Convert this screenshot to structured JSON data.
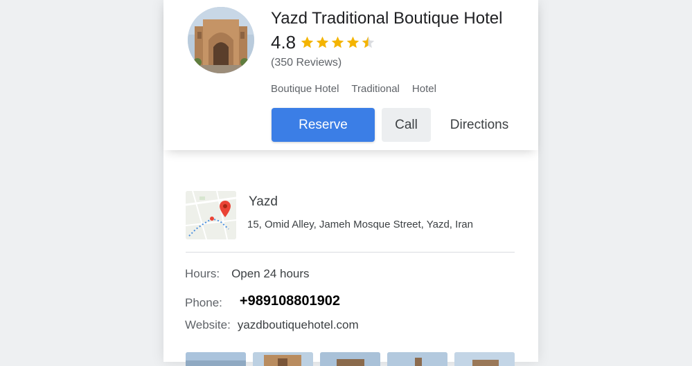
{
  "hotel": {
    "name": "Yazd Traditional Boutique Hotel",
    "rating": "4.8",
    "stars_value": 4.5,
    "reviews": "(350 Reviews)",
    "tags": [
      "Boutique Hotel",
      "Traditional",
      "Hotel"
    ]
  },
  "actions": {
    "reserve": "Reserve",
    "call": "Call",
    "directions": "Directions"
  },
  "location": {
    "city": "Yazd",
    "address": "15, Omid Alley, Jameh Mosque Street, Yazd, Iran"
  },
  "info": {
    "hours_label": "Hours:",
    "hours_value": "Open 24 hours",
    "phone_label": "Phone:",
    "phone_value": "+989108801902",
    "website_label": "Website:",
    "website_value": "yazdboutiquehotel.com"
  },
  "colors": {
    "accent": "#3b7ee6",
    "star": "#f4b400",
    "map_pin": "#ea4335"
  },
  "photos_count": 5
}
